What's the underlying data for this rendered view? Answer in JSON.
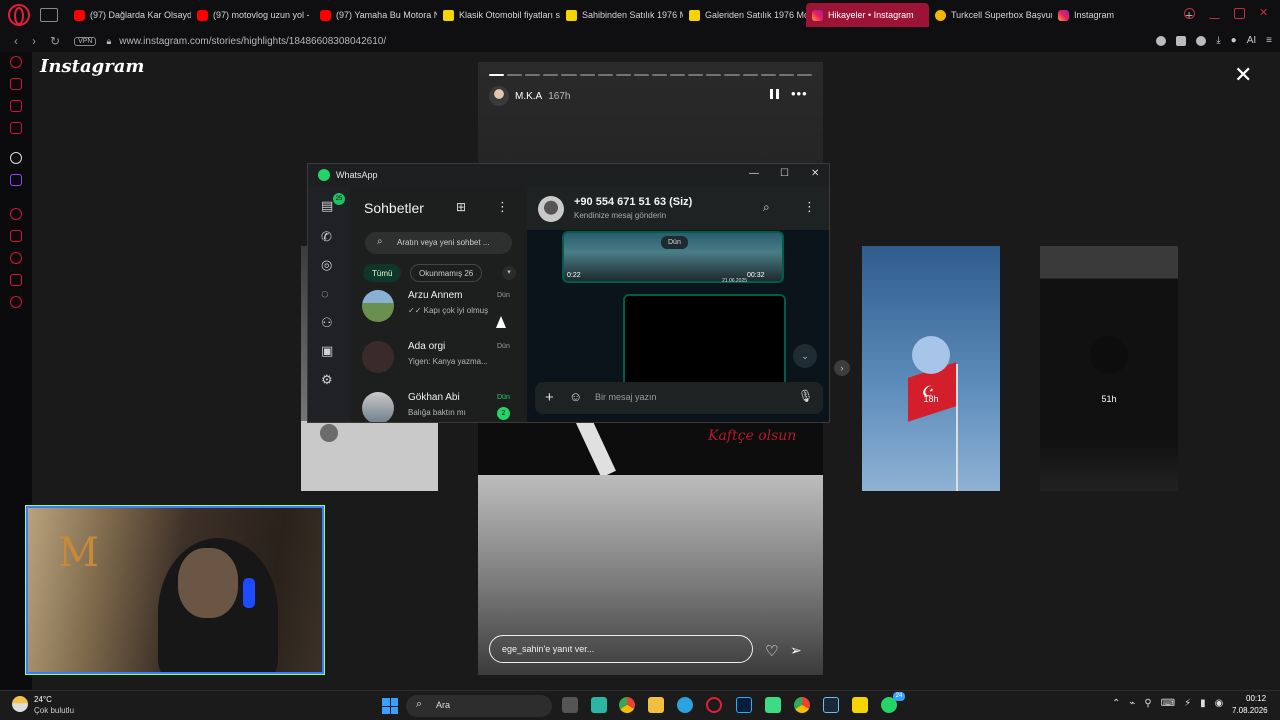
{
  "browser": {
    "tabs": [
      {
        "label": "(97) Dağlarda Kar Olsaydı",
        "favicon": "youtube-icon",
        "active": false
      },
      {
        "label": "(97) motovlog uzun yol -",
        "favicon": "youtube-icon",
        "active": false
      },
      {
        "label": "(97) Yamaha Bu Motora N",
        "favicon": "youtube-icon",
        "active": false
      },
      {
        "label": "Klasik Otomobil fiyatları s",
        "favicon": "sahibinden-icon",
        "active": false
      },
      {
        "label": "Sahibinden Satılık 1976 M",
        "favicon": "sahibinden-icon",
        "active": false
      },
      {
        "label": "Galeriden Satılık 1976 Mo",
        "favicon": "sahibinden-icon",
        "active": false
      },
      {
        "label": "Hikayeler • Instagram",
        "favicon": "instagram-icon",
        "active": true
      },
      {
        "label": "Turkcell Superbox Başvur",
        "favicon": "turkcell-icon",
        "active": false
      },
      {
        "label": "Instagram",
        "favicon": "instagram-icon",
        "active": false
      }
    ],
    "new_tab": "+",
    "vpn": "VPN",
    "url": "www.instagram.com/stories/highlights/18486608308042610/",
    "ai": "AI",
    "accent": "#9c1336"
  },
  "instagram": {
    "logo": "Instagram",
    "close": "✕",
    "story": {
      "username": "M.K.A",
      "time": "167h",
      "script_text": "Kaftçe olsun",
      "reply_placeholder": "ege_sahin'e yanıt ver...",
      "progress_total": 18,
      "progress_done": 1
    },
    "side_stories": [
      {
        "time": "18h"
      },
      {
        "time": "51h"
      }
    ],
    "next_arrow": "›"
  },
  "whatsapp": {
    "window_title": "WhatsApp",
    "minimize": "—",
    "maximize": "☐",
    "close": "✕",
    "rail_badge": "25",
    "chats_title": "Sohbetler",
    "search_placeholder": "Aratın veya yeni sohbet ...",
    "filters": {
      "all": "Tümü",
      "unread": "Okunmamış 26"
    },
    "chats": [
      {
        "name": "Arzu Annem",
        "time": "Dün",
        "message": "✓✓ Kapı çok iyi olmuş",
        "unread": ""
      },
      {
        "name": "Ada orgi",
        "time": "Dün",
        "message": "Yigen: Kanya yazma...",
        "unread": ""
      },
      {
        "name": "Gökhan Abi",
        "time": "Dün",
        "message": "Balığa baktın mı",
        "unread": "2"
      }
    ],
    "conversation": {
      "name": "+90 554 671 51 63 (Siz)",
      "subtitle": "Kendinize mesaj gönderin",
      "day_chip": "Dün",
      "video_duration": "0:22",
      "video_time": "00:32",
      "video_date": "21.06.2025",
      "compose_placeholder": "Bir mesaj yazın"
    },
    "accent": "#25d366"
  },
  "taskbar": {
    "weather_temp": "24°C",
    "weather_desc": "Çok bulutlu",
    "search": "Ara",
    "whatsapp_badge": "24",
    "clock_time": "00:12",
    "clock_date": "7.08.2026"
  }
}
